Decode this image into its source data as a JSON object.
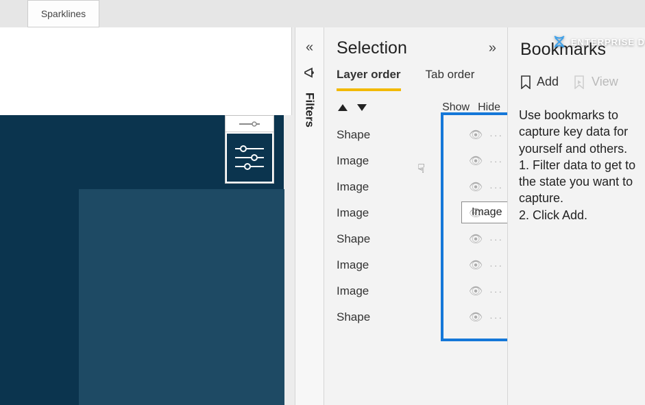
{
  "ribbon": {
    "tab": "Sparklines"
  },
  "filters": {
    "label": "Filters"
  },
  "selection": {
    "title": "Selection",
    "tabs": {
      "layer": "Layer order",
      "tab": "Tab order"
    },
    "show": "Show",
    "hide": "Hide",
    "items": [
      {
        "name": "Shape"
      },
      {
        "name": "Image"
      },
      {
        "name": "Image"
      },
      {
        "name": "Image"
      },
      {
        "name": "Shape"
      },
      {
        "name": "Image"
      },
      {
        "name": "Image"
      },
      {
        "name": "Shape"
      }
    ],
    "tooltip": "Image"
  },
  "bookmarks": {
    "title": "Bookmarks",
    "add": "Add",
    "view": "View",
    "desc1": "Use bookmarks to capture key data for yourself and others.",
    "desc2": "1. Filter data to get to the state you want to capture.",
    "desc3": "2. Click Add."
  },
  "brand": "ENTERPRISE D"
}
